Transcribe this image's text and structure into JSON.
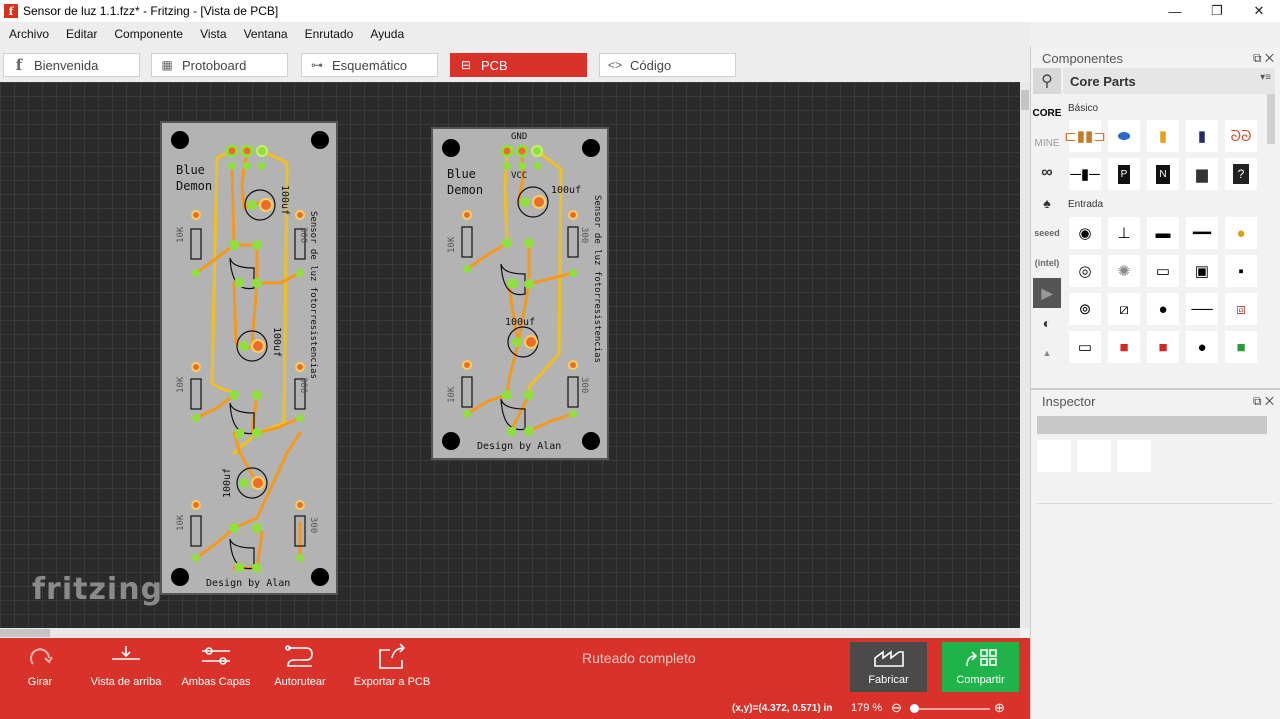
{
  "window": {
    "title": "Sensor de luz 1.1.fzz* - Fritzing - [Vista de PCB]",
    "app_icon": "f",
    "controls": [
      "—",
      "❐",
      "✕"
    ]
  },
  "menu": [
    "Archivo",
    "Editar",
    "Componente",
    "Vista",
    "Ventana",
    "Enrutado",
    "Ayuda"
  ],
  "tabs": [
    {
      "label": "Bienvenida",
      "icon": "fritzing-f-icon",
      "glyph": "f"
    },
    {
      "label": "Protoboard",
      "icon": "breadboard-icon",
      "glyph": "▦"
    },
    {
      "label": "Esquemático",
      "icon": "schematic-icon",
      "glyph": "⊶"
    },
    {
      "label": "PCB",
      "icon": "pcb-icon",
      "glyph": "⊟"
    },
    {
      "label": "Código",
      "icon": "code-icon",
      "glyph": "<>"
    }
  ],
  "boards": {
    "left": {
      "brand": "Blue",
      "brand2": "Demon",
      "credit": "Design by Alan",
      "vertical_title": "Sensor de luz fotorresistencias",
      "res_label": "10K",
      "res_label2": "300",
      "cap1": "100uf",
      "cap2": "100uf",
      "cap3": "100uf"
    },
    "right": {
      "brand": "Blue",
      "brand2": "Demon",
      "credit": "Design by Alan",
      "vertical_title": "Sensor de luz fotorresistencias",
      "gnd": "GND",
      "vcc": "VCC",
      "res_label": "10K",
      "res_label2": "300",
      "cap1": "100uf",
      "cap2": "100uf"
    }
  },
  "watermark": "fritzing",
  "toolbar": {
    "rotate": "Girar",
    "view_from_above": "Vista de arriba",
    "both_layers": "Ambas Capas",
    "autoroute": "Autorutear",
    "export_pcb": "Exportar a PCB",
    "routing_status": "Ruteado completo",
    "fabricate": "Fabricar",
    "share": "Compartir"
  },
  "status": {
    "coords": "(x,y)=(4.372, 0.571) in",
    "zoom": "179 %",
    "zoom_level": 0.05
  },
  "components_panel": {
    "title": "Componentes",
    "bin_title": "Core Parts",
    "bins": [
      "CORE",
      "MINE"
    ],
    "section_basic": "Básico",
    "section_input": "Entrada"
  },
  "inspector": {
    "title": "Inspector"
  },
  "colors": {
    "accent": "#d8322a",
    "board": "#b3b3b3",
    "trace": "#f39a1e",
    "trace_top": "#f0c020",
    "pad_green": "#8fe03c",
    "pad_orange": "#f06a2a"
  }
}
